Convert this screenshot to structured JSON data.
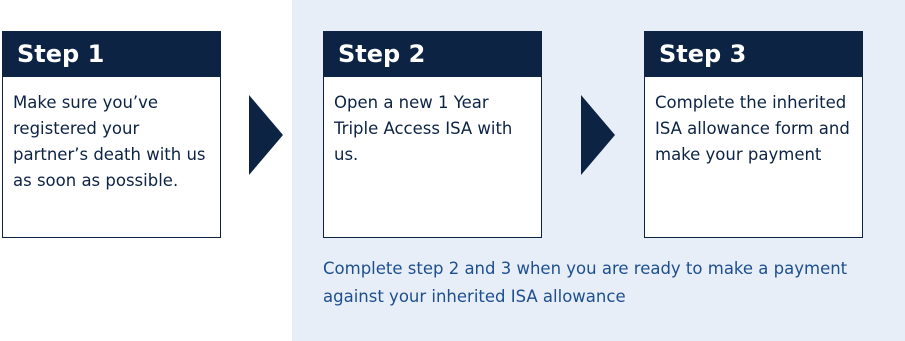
{
  "steps": [
    {
      "title": "Step 1",
      "text": "Make sure you’ve registered your partner’s death with us as soon as possible."
    },
    {
      "title": "Step 2",
      "text": "Open a new 1 Year Triple Access ISA with us."
    },
    {
      "title": "Step 3",
      "text": "Complete the inherited ISA allowance form and make your payment"
    }
  ],
  "note": "Complete step 2 and 3 when you are ready to make a payment against your inherited ISA allowance",
  "colors": {
    "navy": "#0d2344",
    "panel_background": "#e8eef8",
    "note_text": "#1d4f8f"
  }
}
